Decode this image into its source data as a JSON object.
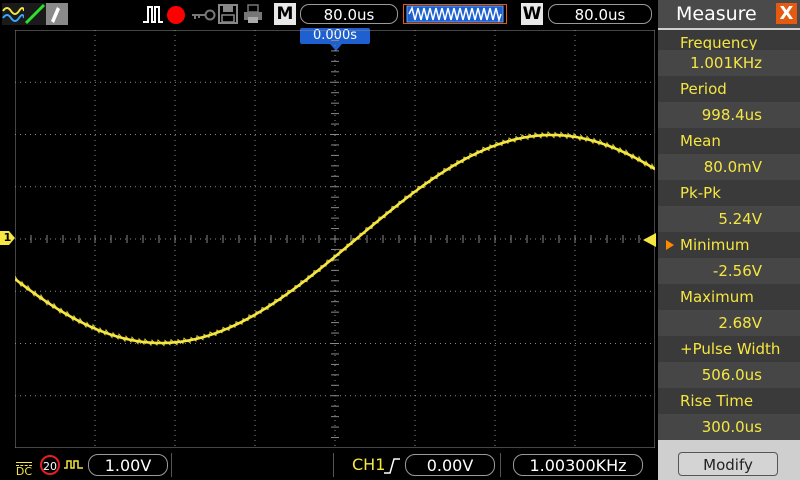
{
  "toolbar": {
    "mode_letter": "M",
    "timebase": "80.0us",
    "window_letter": "W",
    "window_timebase": "80.0us",
    "icons": [
      "waveform-icon",
      "ramp-icon",
      "probe-icon",
      "trigger-pulse-icon",
      "record-icon",
      "key-icon",
      "save-icon",
      "print-icon"
    ],
    "record_color": "#ff0000"
  },
  "trigger_position": "0.000s",
  "channel_marker_label": "1",
  "measure": {
    "title": "Measure",
    "close_label": "X",
    "items": [
      {
        "label": "Frequency",
        "value": "1.001KHz"
      },
      {
        "label": "Period",
        "value": "998.4us"
      },
      {
        "label": "Mean",
        "value": "80.0mV"
      },
      {
        "label": "Pk-Pk",
        "value": "5.24V"
      },
      {
        "label": "Minimum",
        "value": "-2.56V",
        "selected": true
      },
      {
        "label": "Maximum",
        "value": "2.68V"
      },
      {
        "label": "+Pulse Width",
        "value": "506.0us"
      },
      {
        "label": "Rise Time",
        "value": "300.0us"
      }
    ],
    "modify_label": "Modify"
  },
  "bottom": {
    "coupling": "DC",
    "bw_limit": "20",
    "volts_per_div": "1.00V",
    "trigger_source": "CH1",
    "trigger_level": "0.00V",
    "trigger_frequency": "1.00300KHz"
  },
  "colors": {
    "trace": "#f5e642",
    "grid": "#8a8a8a",
    "accent_blue": "#1f60d0",
    "close_orange": "#e35a10",
    "selected_arrow": "#ff8a00"
  }
}
